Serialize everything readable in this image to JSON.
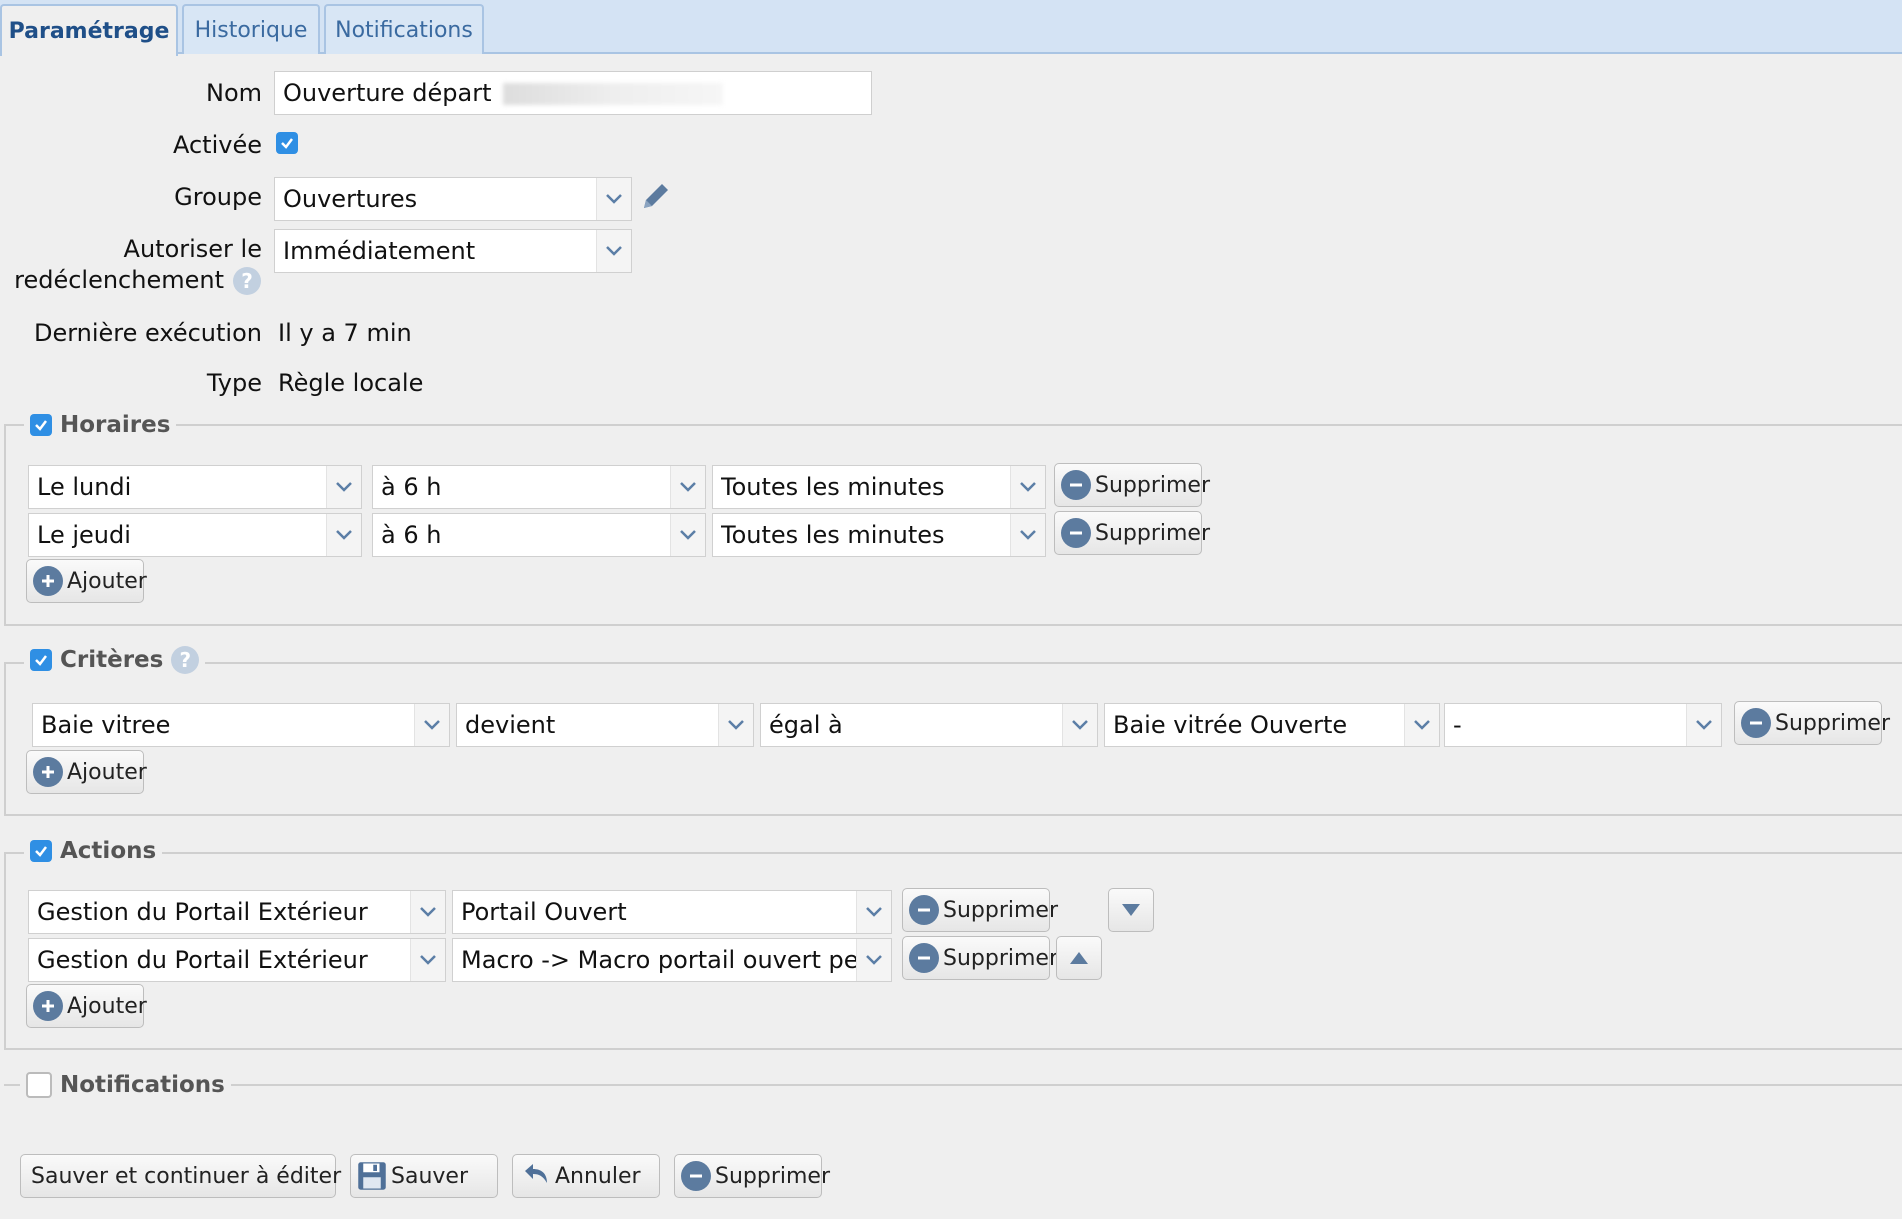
{
  "tabs": [
    "Paramétrage",
    "Historique",
    "Notifications"
  ],
  "form": {
    "nom_label": "Nom",
    "nom_value": "Ouverture départ",
    "activee_label": "Activée",
    "groupe_label": "Groupe",
    "groupe_value": "Ouvertures",
    "autoriser_label_1": "Autoriser le",
    "autoriser_label_2": "redéclenchement",
    "autoriser_value": "Immédiatement",
    "derniere_label": "Dernière exécution",
    "derniere_value": "Il y a 7 min",
    "type_label": "Type",
    "type_value": "Règle locale"
  },
  "horaires": {
    "title": "Horaires",
    "rows": [
      {
        "jour": "Le lundi",
        "heure": "à 6 h",
        "minutes": "Toutes les minutes",
        "delete": "Supprimer"
      },
      {
        "jour": "Le jeudi",
        "heure": "à 6 h",
        "minutes": "Toutes les minutes",
        "delete": "Supprimer"
      }
    ],
    "add": "Ajouter"
  },
  "criteres": {
    "title": "Critères",
    "row": {
      "device": "Baie vitree",
      "event": "devient",
      "op": "égal à",
      "value": "Baie vitrée Ouverte",
      "extra": "-",
      "delete": "Supprimer"
    },
    "add": "Ajouter"
  },
  "actions": {
    "title": "Actions",
    "rows": [
      {
        "device": "Gestion du Portail Extérieur",
        "action": "Portail Ouvert",
        "delete": "Supprimer"
      },
      {
        "device": "Gestion du Portail Extérieur",
        "action": "Macro -> Macro portail ouvert penda",
        "delete": "Supprimer"
      }
    ],
    "add": "Ajouter"
  },
  "notifications": {
    "title": "Notifications"
  },
  "footer": {
    "save_continue": "Sauver et continuer à éditer",
    "save": "Sauver",
    "cancel": "Annuler",
    "delete": "Supprimer"
  }
}
